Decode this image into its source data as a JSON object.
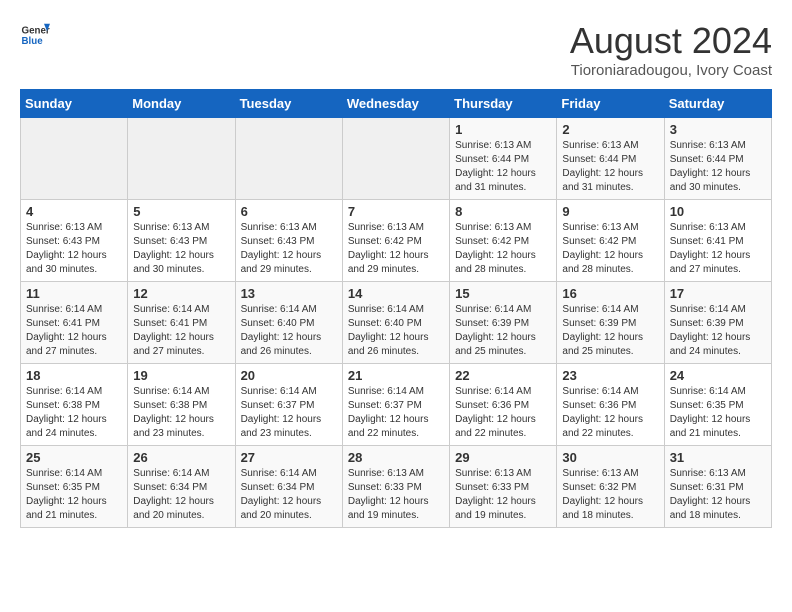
{
  "header": {
    "logo_general": "General",
    "logo_blue": "Blue",
    "month": "August 2024",
    "location": "Tioroniaradougou, Ivory Coast"
  },
  "weekdays": [
    "Sunday",
    "Monday",
    "Tuesday",
    "Wednesday",
    "Thursday",
    "Friday",
    "Saturday"
  ],
  "weeks": [
    [
      {
        "day": "",
        "info": ""
      },
      {
        "day": "",
        "info": ""
      },
      {
        "day": "",
        "info": ""
      },
      {
        "day": "",
        "info": ""
      },
      {
        "day": "1",
        "info": "Sunrise: 6:13 AM\nSunset: 6:44 PM\nDaylight: 12 hours\nand 31 minutes."
      },
      {
        "day": "2",
        "info": "Sunrise: 6:13 AM\nSunset: 6:44 PM\nDaylight: 12 hours\nand 31 minutes."
      },
      {
        "day": "3",
        "info": "Sunrise: 6:13 AM\nSunset: 6:44 PM\nDaylight: 12 hours\nand 30 minutes."
      }
    ],
    [
      {
        "day": "4",
        "info": "Sunrise: 6:13 AM\nSunset: 6:43 PM\nDaylight: 12 hours\nand 30 minutes."
      },
      {
        "day": "5",
        "info": "Sunrise: 6:13 AM\nSunset: 6:43 PM\nDaylight: 12 hours\nand 30 minutes."
      },
      {
        "day": "6",
        "info": "Sunrise: 6:13 AM\nSunset: 6:43 PM\nDaylight: 12 hours\nand 29 minutes."
      },
      {
        "day": "7",
        "info": "Sunrise: 6:13 AM\nSunset: 6:42 PM\nDaylight: 12 hours\nand 29 minutes."
      },
      {
        "day": "8",
        "info": "Sunrise: 6:13 AM\nSunset: 6:42 PM\nDaylight: 12 hours\nand 28 minutes."
      },
      {
        "day": "9",
        "info": "Sunrise: 6:13 AM\nSunset: 6:42 PM\nDaylight: 12 hours\nand 28 minutes."
      },
      {
        "day": "10",
        "info": "Sunrise: 6:13 AM\nSunset: 6:41 PM\nDaylight: 12 hours\nand 27 minutes."
      }
    ],
    [
      {
        "day": "11",
        "info": "Sunrise: 6:14 AM\nSunset: 6:41 PM\nDaylight: 12 hours\nand 27 minutes."
      },
      {
        "day": "12",
        "info": "Sunrise: 6:14 AM\nSunset: 6:41 PM\nDaylight: 12 hours\nand 27 minutes."
      },
      {
        "day": "13",
        "info": "Sunrise: 6:14 AM\nSunset: 6:40 PM\nDaylight: 12 hours\nand 26 minutes."
      },
      {
        "day": "14",
        "info": "Sunrise: 6:14 AM\nSunset: 6:40 PM\nDaylight: 12 hours\nand 26 minutes."
      },
      {
        "day": "15",
        "info": "Sunrise: 6:14 AM\nSunset: 6:39 PM\nDaylight: 12 hours\nand 25 minutes."
      },
      {
        "day": "16",
        "info": "Sunrise: 6:14 AM\nSunset: 6:39 PM\nDaylight: 12 hours\nand 25 minutes."
      },
      {
        "day": "17",
        "info": "Sunrise: 6:14 AM\nSunset: 6:39 PM\nDaylight: 12 hours\nand 24 minutes."
      }
    ],
    [
      {
        "day": "18",
        "info": "Sunrise: 6:14 AM\nSunset: 6:38 PM\nDaylight: 12 hours\nand 24 minutes."
      },
      {
        "day": "19",
        "info": "Sunrise: 6:14 AM\nSunset: 6:38 PM\nDaylight: 12 hours\nand 23 minutes."
      },
      {
        "day": "20",
        "info": "Sunrise: 6:14 AM\nSunset: 6:37 PM\nDaylight: 12 hours\nand 23 minutes."
      },
      {
        "day": "21",
        "info": "Sunrise: 6:14 AM\nSunset: 6:37 PM\nDaylight: 12 hours\nand 22 minutes."
      },
      {
        "day": "22",
        "info": "Sunrise: 6:14 AM\nSunset: 6:36 PM\nDaylight: 12 hours\nand 22 minutes."
      },
      {
        "day": "23",
        "info": "Sunrise: 6:14 AM\nSunset: 6:36 PM\nDaylight: 12 hours\nand 22 minutes."
      },
      {
        "day": "24",
        "info": "Sunrise: 6:14 AM\nSunset: 6:35 PM\nDaylight: 12 hours\nand 21 minutes."
      }
    ],
    [
      {
        "day": "25",
        "info": "Sunrise: 6:14 AM\nSunset: 6:35 PM\nDaylight: 12 hours\nand 21 minutes."
      },
      {
        "day": "26",
        "info": "Sunrise: 6:14 AM\nSunset: 6:34 PM\nDaylight: 12 hours\nand 20 minutes."
      },
      {
        "day": "27",
        "info": "Sunrise: 6:14 AM\nSunset: 6:34 PM\nDaylight: 12 hours\nand 20 minutes."
      },
      {
        "day": "28",
        "info": "Sunrise: 6:13 AM\nSunset: 6:33 PM\nDaylight: 12 hours\nand 19 minutes."
      },
      {
        "day": "29",
        "info": "Sunrise: 6:13 AM\nSunset: 6:33 PM\nDaylight: 12 hours\nand 19 minutes."
      },
      {
        "day": "30",
        "info": "Sunrise: 6:13 AM\nSunset: 6:32 PM\nDaylight: 12 hours\nand 18 minutes."
      },
      {
        "day": "31",
        "info": "Sunrise: 6:13 AM\nSunset: 6:31 PM\nDaylight: 12 hours\nand 18 minutes."
      }
    ]
  ]
}
